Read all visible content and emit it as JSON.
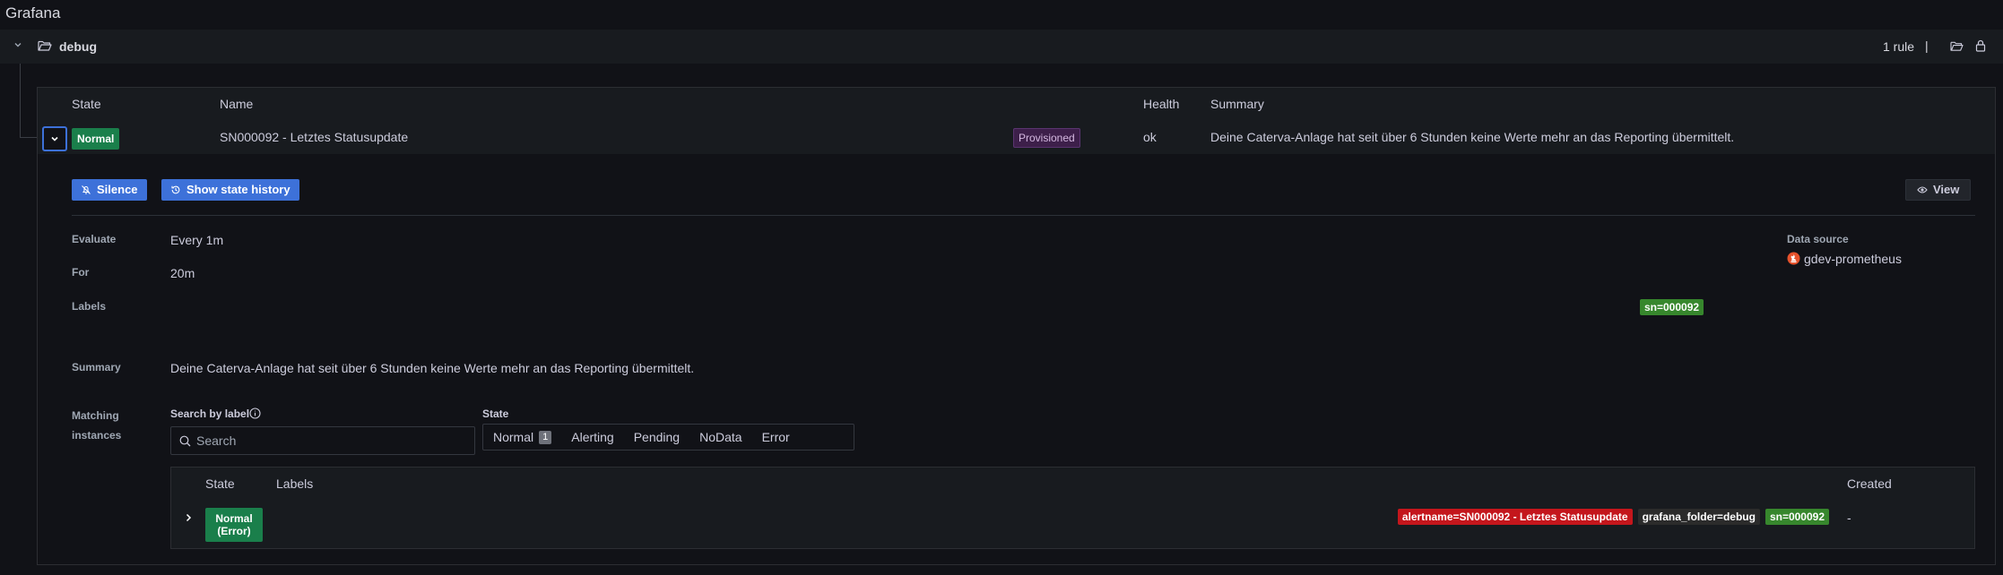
{
  "app_title": "Grafana",
  "group": {
    "folder_name": "debug",
    "rule_count": "1 rule",
    "separator": "|"
  },
  "table": {
    "headers": {
      "state": "State",
      "name": "Name",
      "health": "Health",
      "summary": "Summary"
    },
    "rule": {
      "state": "Normal",
      "name": "SN000092 - Letztes Statusupdate",
      "provisioned": "Provisioned",
      "health": "ok",
      "summary": "Deine Caterva-Anlage hat seit über 6 Stunden keine Werte mehr an das Reporting übermittelt."
    }
  },
  "actions": {
    "silence": "Silence",
    "show_state_history": "Show state history",
    "view": "View"
  },
  "details": {
    "evaluate_label": "Evaluate",
    "evaluate_value": "Every 1m",
    "for_label": "For",
    "for_value": "20m",
    "labels_label": "Labels",
    "label_tag": "sn=000092",
    "summary_label": "Summary",
    "summary_value": "Deine Caterva-Anlage hat seit über 6 Stunden keine Werte mehr an das Reporting übermittelt.",
    "data_source_label": "Data source",
    "data_source_value": "gdev-prometheus",
    "matching_label_line1": "Matching",
    "matching_label_line2": "instances"
  },
  "filters": {
    "search_label": "Search by label",
    "search_placeholder": "Search",
    "state_label": "State",
    "states": [
      {
        "label": "Normal",
        "count": "1"
      },
      {
        "label": "Alerting"
      },
      {
        "label": "Pending"
      },
      {
        "label": "NoData"
      },
      {
        "label": "Error"
      }
    ]
  },
  "instances": {
    "headers": {
      "state": "State",
      "labels": "Labels",
      "created": "Created"
    },
    "row": {
      "state_line1": "Normal",
      "state_line2": "(Error)",
      "labels": [
        "alertname=SN000092 - Letztes Statusupdate",
        "grafana_folder=debug",
        "sn=000092"
      ],
      "created": "-"
    }
  },
  "colors": {
    "background": "#111217",
    "panel": "#181b1f",
    "primary": "#3d71d9",
    "state_normal": "#1a7f4b",
    "label_green": "#37872d",
    "label_red": "#c4161c"
  }
}
